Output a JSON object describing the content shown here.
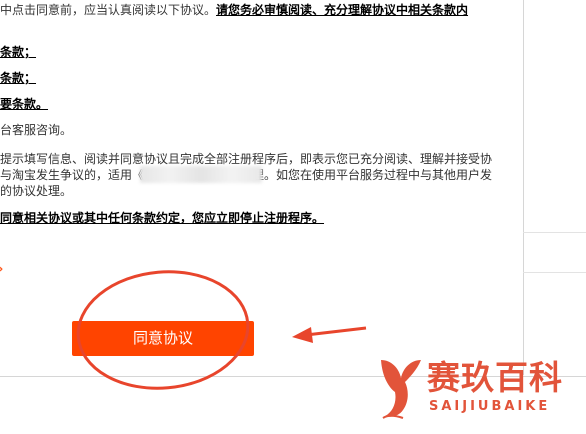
{
  "agreement": {
    "intro_plain": "中点击同意前，应当认真阅读以下协议。",
    "intro_bold": "请您务必审慎阅读、充分理解协议中相关条款内",
    "clauses": [
      "条款；",
      "条款；",
      "要条款。"
    ],
    "consult": "台客服咨询。",
    "para_lines": [
      "提示填写信息、阅读并同意协议且完成全部注册程序后，即表示您已充分阅读、理解并接受协",
      "与淘宝发生争议的，适用《",
      "的协议处理。"
    ],
    "para_line2_tail": "理。如您在使用平台服务过程中与其他用户发",
    "warning": "同意相关协议或其中任何条款约定，您应立即停止注册程序。"
  },
  "agree_button": {
    "label": "同意协议"
  },
  "watermark": {
    "name_cn": "赛玖百科",
    "name_en": "SAIJIUBAIKE"
  },
  "colors": {
    "button": "#ff4400",
    "annotation": "#e8452c",
    "watermark": "#e2543a"
  }
}
